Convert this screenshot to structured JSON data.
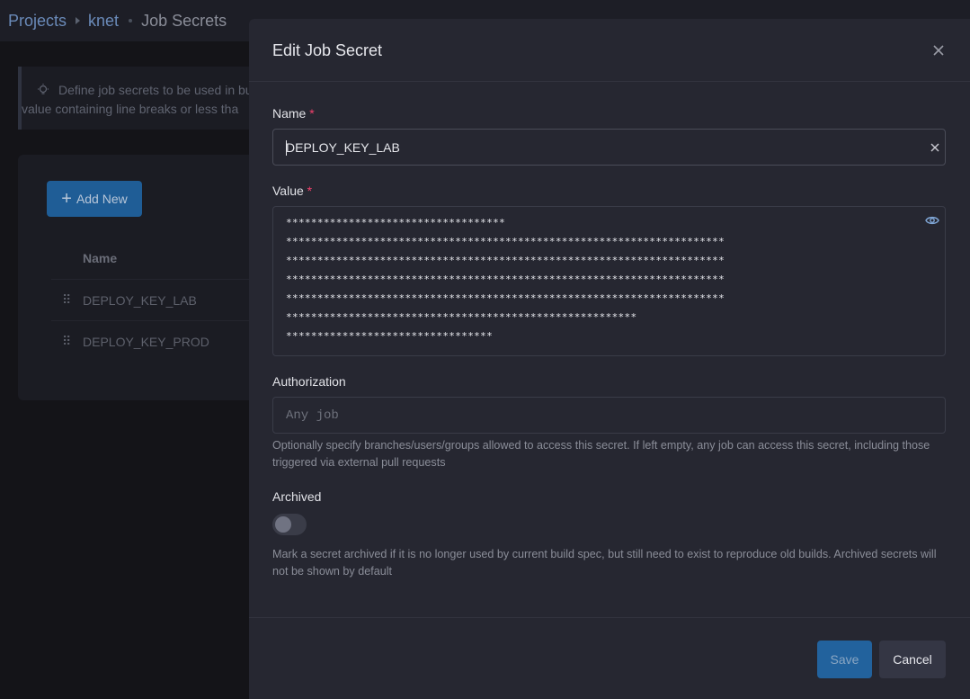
{
  "breadcrumb": {
    "items": [
      "Projects",
      "knet",
      "Job Secrets"
    ]
  },
  "tip": {
    "line1": "Define job secrets to be used in bu",
    "line2": "value containing line breaks or less tha"
  },
  "secrets_list": {
    "add_label": "Add New",
    "column_name": "Name",
    "rows": [
      "DEPLOY_KEY_LAB",
      "DEPLOY_KEY_PROD"
    ]
  },
  "modal": {
    "title": "Edit Job Secret",
    "name": {
      "label": "Name",
      "required_mark": "*",
      "value": "DEPLOY_KEY_LAB"
    },
    "value": {
      "label": "Value",
      "required_mark": "*",
      "masked_lines": [
        "***********************************",
        "**********************************************************************",
        "**********************************************************************",
        "**********************************************************************",
        "**********************************************************************",
        "********************************************************",
        "*********************************"
      ]
    },
    "authorization": {
      "label": "Authorization",
      "placeholder": "Any job",
      "help": "Optionally specify branches/users/groups allowed to access this secret. If left empty, any job can access this secret, including those triggered via external pull requests"
    },
    "archived": {
      "label": "Archived",
      "checked": false,
      "help": "Mark a secret archived if it is no longer used by current build spec, but still need to exist to reproduce old builds. Archived secrets will not be shown by default"
    },
    "save_label": "Save",
    "cancel_label": "Cancel"
  },
  "colors": {
    "primary": "#22629d",
    "required": "#f1416c",
    "link": "#6a8ab8"
  }
}
